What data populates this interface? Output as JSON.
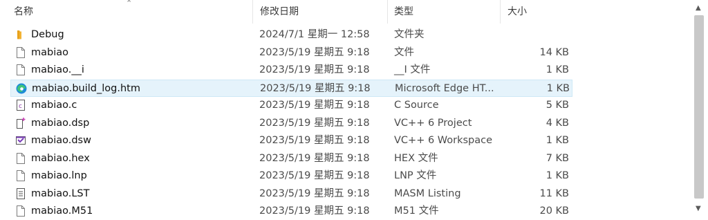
{
  "columns": {
    "name": "名称",
    "date": "修改日期",
    "type": "类型",
    "size": "大小"
  },
  "files": [
    {
      "name": "Debug",
      "date": "2024/7/1 星期一 12:58",
      "type": "文件夹",
      "size": "",
      "icon": "folder-icon"
    },
    {
      "name": "mabiao",
      "date": "2023/5/19 星期五 9:18",
      "type": "文件",
      "size": "14 KB",
      "icon": "file-icon"
    },
    {
      "name": "mabiao.__i",
      "date": "2023/5/19 星期五 9:18",
      "type": "__I 文件",
      "size": "1 KB",
      "icon": "file-icon"
    },
    {
      "name": "mabiao.build_log.htm",
      "date": "2023/5/19 星期五 9:18",
      "type": "Microsoft Edge HT...",
      "size": "1 KB",
      "icon": "edge-icon",
      "selected": true
    },
    {
      "name": "mabiao.c",
      "date": "2023/5/19 星期五 9:18",
      "type": "C Source",
      "size": "5 KB",
      "icon": "c-source-icon"
    },
    {
      "name": "mabiao.dsp",
      "date": "2023/5/19 星期五 9:18",
      "type": "VC++ 6 Project",
      "size": "4 KB",
      "icon": "project-file-icon"
    },
    {
      "name": "mabiao.dsw",
      "date": "2023/5/19 星期五 9:18",
      "type": "VC++ 6 Workspace",
      "size": "1 KB",
      "icon": "visual-studio-icon"
    },
    {
      "name": "mabiao.hex",
      "date": "2023/5/19 星期五 9:18",
      "type": "HEX 文件",
      "size": "7 KB",
      "icon": "file-icon"
    },
    {
      "name": "mabiao.lnp",
      "date": "2023/5/19 星期五 9:18",
      "type": "LNP 文件",
      "size": "1 KB",
      "icon": "file-icon"
    },
    {
      "name": "mabiao.LST",
      "date": "2023/5/19 星期五 9:18",
      "type": "MASM Listing",
      "size": "11 KB",
      "icon": "text-document-icon"
    },
    {
      "name": "mabiao.M51",
      "date": "2023/5/19 星期五 9:18",
      "type": "M51 文件",
      "size": "20 KB",
      "icon": "file-icon"
    }
  ]
}
